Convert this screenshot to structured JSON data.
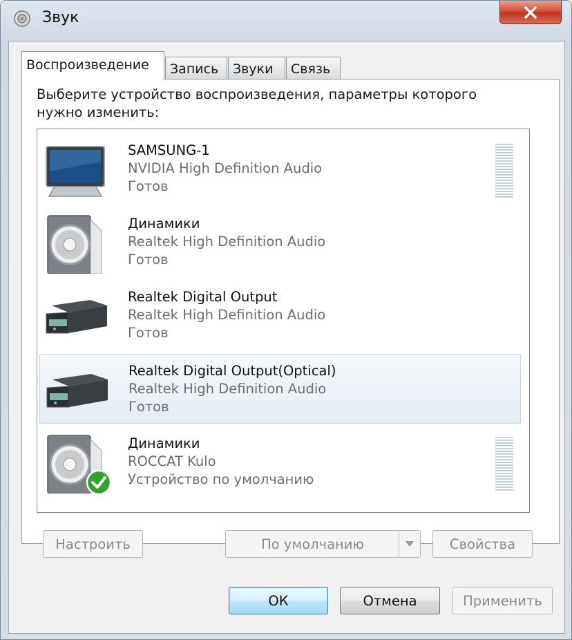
{
  "window": {
    "title": "Звук"
  },
  "tabs": [
    {
      "label": "Воспроизведение",
      "active": true
    },
    {
      "label": "Запись",
      "active": false
    },
    {
      "label": "Звуки",
      "active": false
    },
    {
      "label": "Связь",
      "active": false
    }
  ],
  "instruction": "Выберите устройство воспроизведения, параметры которого нужно изменить:",
  "devices": [
    {
      "name": "SAMSUNG-1",
      "driver": "NVIDIA High Definition Audio",
      "status": "Готов",
      "icon": "monitor-icon",
      "level_meter": true,
      "selected": false,
      "default": false
    },
    {
      "name": "Динамики",
      "driver": "Realtek High Definition Audio",
      "status": "Готов",
      "icon": "speaker-icon",
      "level_meter": false,
      "selected": false,
      "default": false
    },
    {
      "name": "Realtek Digital Output",
      "driver": "Realtek High Definition Audio",
      "status": "Готов",
      "icon": "receiver-icon",
      "level_meter": false,
      "selected": false,
      "default": false
    },
    {
      "name": "Realtek Digital Output(Optical)",
      "driver": "Realtek High Definition Audio",
      "status": "Готов",
      "icon": "receiver-icon",
      "level_meter": false,
      "selected": true,
      "default": false
    },
    {
      "name": "Динамики",
      "driver": "ROCCAT Kulo",
      "status": "Устройство по умолчанию",
      "icon": "speaker-icon",
      "level_meter": true,
      "selected": false,
      "default": true
    }
  ],
  "buttons": {
    "configure": "Настроить",
    "set_default": "По умолчанию",
    "properties": "Свойства",
    "ok": "ОК",
    "cancel": "Отмена",
    "apply": "Применить"
  },
  "colors": {
    "accent": "#3c7fb1",
    "close_button": "#c9452c",
    "default_check": "#2da42d"
  }
}
